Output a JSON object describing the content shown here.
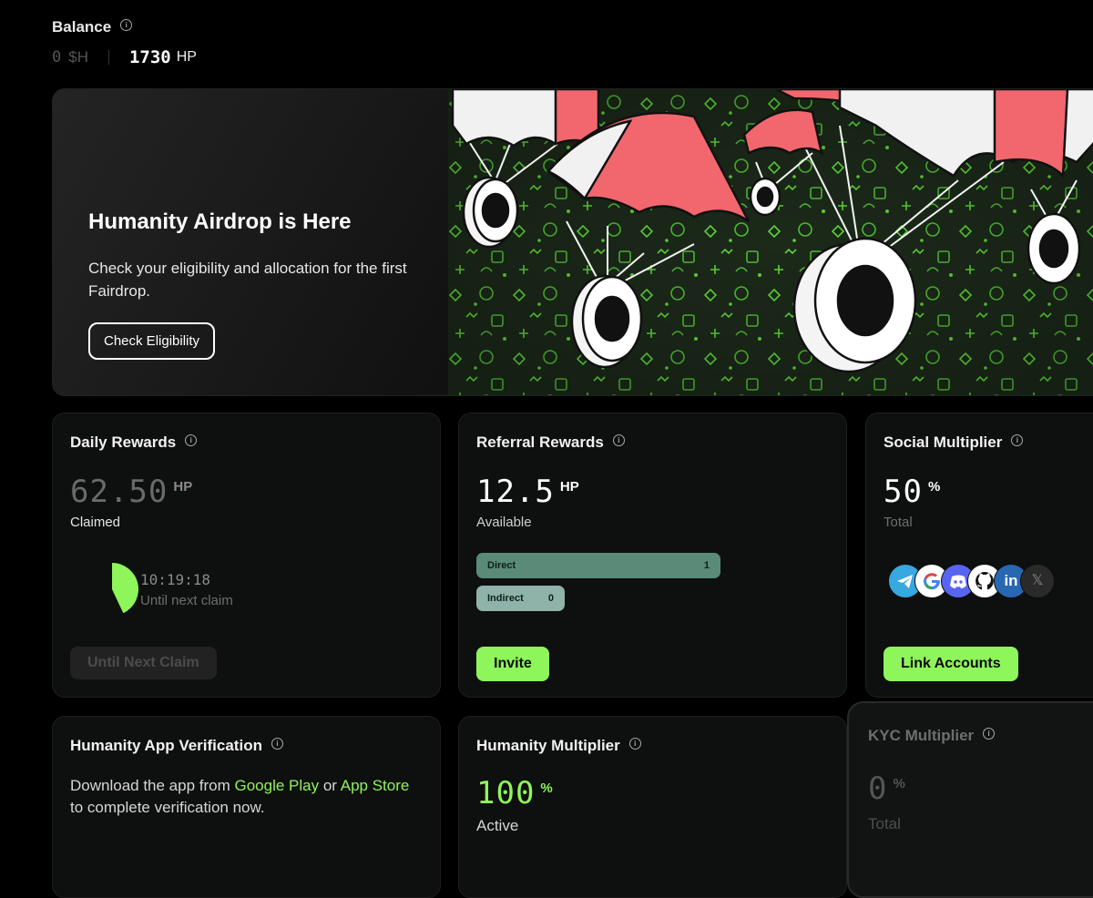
{
  "balance": {
    "title": "Balance",
    "sh_value": "0",
    "sh_unit": "$H",
    "hp_value": "1730",
    "hp_unit": "HP"
  },
  "hero": {
    "title": "Humanity Airdrop is Here",
    "subtitle": "Check your eligibility and allocation for the first Fairdrop.",
    "button": "Check Eligibility"
  },
  "daily": {
    "title": "Daily Rewards",
    "value": "62.50",
    "unit": "HP",
    "status": "Claimed",
    "timer": "10:19:18",
    "timer_label": "Until next claim",
    "button": "Until Next Claim",
    "progress_fraction": 0.43
  },
  "referral": {
    "title": "Referral Rewards",
    "value": "12.5",
    "unit": "HP",
    "status": "Available",
    "direct_label": "Direct",
    "direct_count": "1",
    "indirect_label": "Indirect",
    "indirect_count": "0",
    "button": "Invite"
  },
  "social": {
    "title": "Social Multiplier",
    "value": "50",
    "unit": "%",
    "status": "Total",
    "icons": [
      "telegram-icon",
      "google-icon",
      "discord-icon",
      "github-icon",
      "linkedin-icon",
      "x-icon"
    ],
    "button": "Link Accounts"
  },
  "app_verification": {
    "title": "Humanity App Verification",
    "text_pre": "Download the app from ",
    "link_google": "Google Play",
    "text_or": " or ",
    "link_app": "App Store",
    "text_post": " to complete verification now."
  },
  "humanity_mult": {
    "title": "Humanity Multiplier",
    "value": "100",
    "unit": "%",
    "status": "Active"
  },
  "kyc_mult": {
    "title": "KYC Multiplier",
    "value": "0",
    "unit": "%",
    "status": "Total"
  },
  "colors": {
    "accent_green": "#8ef55a",
    "parachute_red": "#f2676e",
    "pattern_green": "#5fd63a",
    "hero_bg": "#1d2a1b"
  }
}
